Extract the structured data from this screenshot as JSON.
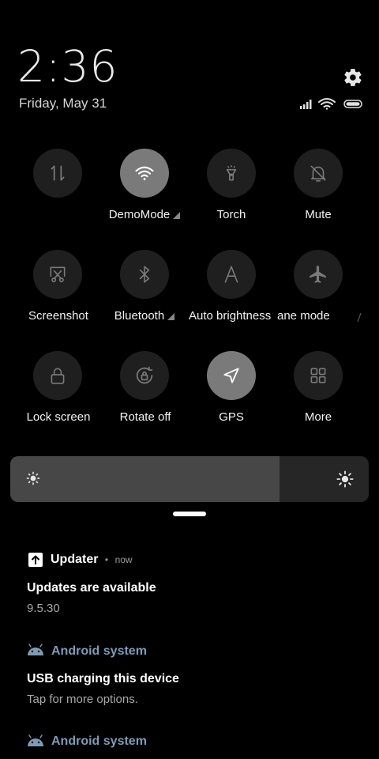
{
  "header": {
    "time": "2:36",
    "date": "Friday, May 31"
  },
  "quick_tiles": [
    {
      "label": "",
      "icon": "data-transfer-icon",
      "active": false
    },
    {
      "label": "DemoMode",
      "icon": "wifi-icon",
      "active": true,
      "has_corner": true
    },
    {
      "label": "Torch",
      "icon": "torch-icon",
      "active": false
    },
    {
      "label": "Mute",
      "icon": "bell-mute-icon",
      "active": false
    },
    {
      "label": "Screenshot",
      "icon": "screenshot-icon",
      "active": false
    },
    {
      "label": "Bluetooth",
      "icon": "bluetooth-icon",
      "active": false,
      "has_corner": true
    },
    {
      "label": "Auto brightness",
      "icon": "auto-brightness-icon",
      "active": false
    },
    {
      "label": "ane mode",
      "icon": "airplane-icon",
      "active": false
    },
    {
      "label": "Lock screen",
      "icon": "lock-icon",
      "active": false
    },
    {
      "label": "Rotate off",
      "icon": "rotate-lock-icon",
      "active": false
    },
    {
      "label": "GPS",
      "icon": "gps-icon",
      "active": true
    },
    {
      "label": "More",
      "icon": "grid-icon",
      "active": false
    }
  ],
  "brightness": {
    "level": 0.75
  },
  "notifications": [
    {
      "app": "Updater",
      "separator": "•",
      "time": "now",
      "title": "Updates are available",
      "text": "9.5.30"
    },
    {
      "app": "Android system",
      "title": "USB charging this device",
      "text": "Tap for more options."
    },
    {
      "app": "Android system"
    }
  ],
  "colors": {
    "background": "#000000",
    "tile_off": "#1f1f1f",
    "tile_on": "#7a7a7a",
    "android_app": "#7d9bb5"
  }
}
